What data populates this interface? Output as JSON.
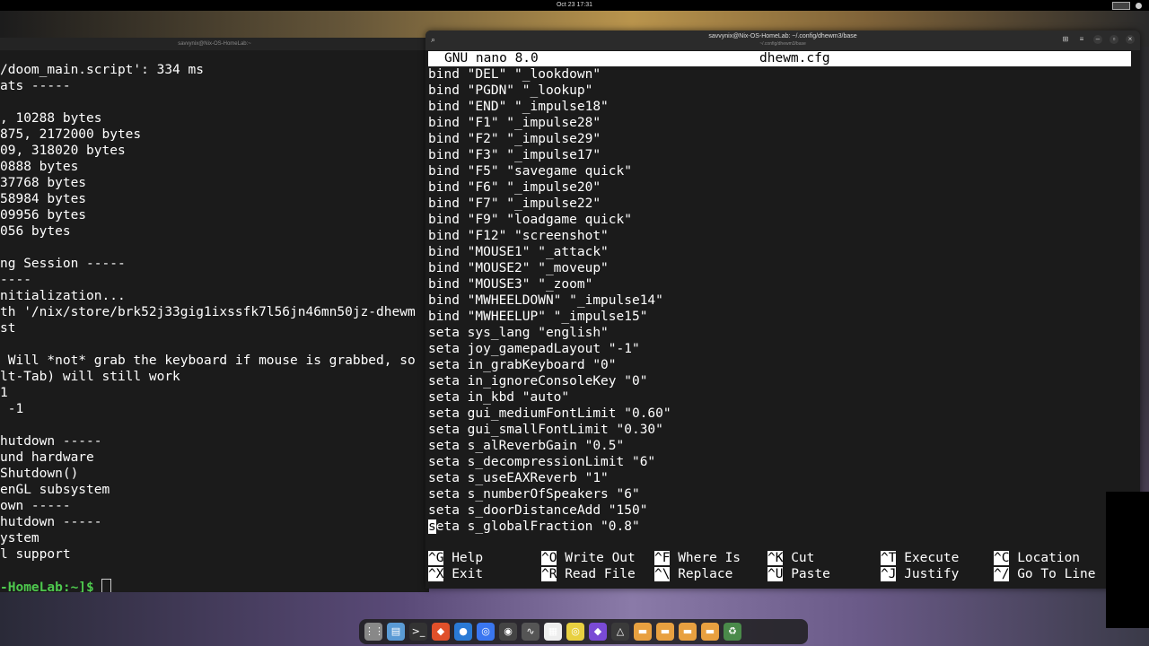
{
  "topbar": {
    "clock": "Oct 23  17:31"
  },
  "left_terminal": {
    "title": "savvynix@Nix-OS-HomeLab:~",
    "lines": [
      "/doom_main.script': 334 ms",
      "ats -----",
      "",
      ", 10288 bytes",
      "875, 2172000 bytes",
      "09, 318020 bytes",
      "0888 bytes",
      "37768 bytes",
      "58984 bytes",
      "09956 bytes",
      "056 bytes",
      "",
      "ng Session -----",
      "----",
      "nitialization...",
      "th '/nix/store/brk52j33gig1ixssfk7l56jn46mn50jz-dhewm",
      "st",
      "",
      " Will *not* grab the keyboard if mouse is grabbed, so",
      "lt-Tab) will still work",
      "1",
      " -1",
      "",
      "hutdown -----",
      "und hardware",
      "Shutdown()",
      "enGL subsystem",
      "own -----",
      "hutdown -----",
      "ystem",
      "l support",
      ""
    ],
    "prompt": "-HomeLab:~]$"
  },
  "nano_window": {
    "title": "savvynix@Nix-OS-HomeLab: ~/.config/dhewm3/base",
    "subtitle": "~/.config/dhewm3/base",
    "version": "GNU nano 8.0",
    "filename": "dhewm.cfg",
    "lines": [
      "bind \"DEL\" \"_lookdown\"",
      "bind \"PGDN\" \"_lookup\"",
      "bind \"END\" \"_impulse18\"",
      "bind \"F1\" \"_impulse28\"",
      "bind \"F2\" \"_impulse29\"",
      "bind \"F3\" \"_impulse17\"",
      "bind \"F5\" \"savegame quick\"",
      "bind \"F6\" \"_impulse20\"",
      "bind \"F7\" \"_impulse22\"",
      "bind \"F9\" \"loadgame quick\"",
      "bind \"F12\" \"screenshot\"",
      "bind \"MOUSE1\" \"_attack\"",
      "bind \"MOUSE2\" \"_moveup\"",
      "bind \"MOUSE3\" \"_zoom\"",
      "bind \"MWHEELDOWN\" \"_impulse14\"",
      "bind \"MWHEELUP\" \"_impulse15\"",
      "seta sys_lang \"english\"",
      "seta joy_gamepadLayout \"-1\"",
      "seta in_grabKeyboard \"0\"",
      "seta in_ignoreConsoleKey \"0\"",
      "seta in_kbd \"auto\"",
      "seta gui_mediumFontLimit \"0.60\"",
      "seta gui_smallFontLimit \"0.30\"",
      "seta s_alReverbGain \"0.5\"",
      "seta s_decompressionLimit \"6\"",
      "seta s_useEAXReverb \"1\"",
      "seta s_numberOfSpeakers \"6\"",
      "seta s_doorDistanceAdd \"150\""
    ],
    "cursor_line_char": "s",
    "cursor_line_rest": "eta s_globalFraction \"0.8\"",
    "shortcuts": [
      {
        "key": "^G",
        "label": "Help"
      },
      {
        "key": "^X",
        "label": "Exit"
      },
      {
        "key": "^O",
        "label": "Write Out"
      },
      {
        "key": "^R",
        "label": "Read File"
      },
      {
        "key": "^F",
        "label": "Where Is"
      },
      {
        "key": "^\\",
        "label": "Replace"
      },
      {
        "key": "^K",
        "label": "Cut"
      },
      {
        "key": "^U",
        "label": "Paste"
      },
      {
        "key": "^T",
        "label": "Execute"
      },
      {
        "key": "^J",
        "label": "Justify"
      },
      {
        "key": "^C",
        "label": "Location"
      },
      {
        "key": "^/",
        "label": "Go To Line"
      }
    ]
  },
  "dock": {
    "items": [
      "apps-grid-icon",
      "files-icon",
      "terminal-icon",
      "brave-icon",
      "thunderbird-icon",
      "signal-icon",
      "obs-icon",
      "audio-icon",
      "calendar-icon",
      "disk-icon",
      "proton-icon",
      "inkscape-icon",
      "folder-icon",
      "folder-icon",
      "folder-icon",
      "folder-icon",
      "trash-icon"
    ],
    "colors": [
      "#888",
      "#5a9ad5",
      "#333",
      "#e0502a",
      "#2a7ad5",
      "#3a76f0",
      "#444",
      "#555",
      "#eee",
      "#e8d040",
      "#7a4ad5",
      "#3a3a3a",
      "#e8a040",
      "#e8a040",
      "#e8a040",
      "#e8a040",
      "#4a8a4a"
    ]
  }
}
